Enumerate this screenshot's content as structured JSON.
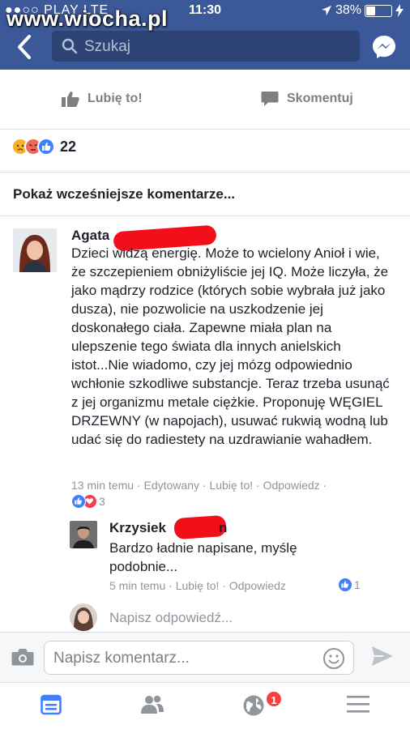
{
  "status_bar": {
    "carrier": "●●○○ PLAY  LTE",
    "time": "11:30",
    "battery": "38%",
    "battery_level": 0.38
  },
  "watermark": "www.wiocha.pl",
  "search": {
    "placeholder": "Szukaj"
  },
  "actions": {
    "like": "Lubię to!",
    "comment": "Skomentuj"
  },
  "reactions": {
    "count": "22"
  },
  "show_earlier": "Pokaż wcześniejsze komentarze...",
  "comments": [
    {
      "author": "Agata",
      "text": "Dzieci widzą energię. Może to wcielony Anioł i wie, że szczepieniem obniżyliście jej IQ. Może liczyła, że jako mądrzy rodzice (których sobie wybrała już jako dusza), nie pozwolicie na uszkodzenie jej doskonałego ciała. Zapewne miała plan na ulepszenie tego świata dla innych anielskich istot...Nie wiadomo, czy jej mózg odpowiednio wchłonie szkodliwe substancje. Teraz trzeba usunąć z jej organizmu metale ciężkie. Proponuję WĘGIEL DRZEWNY (w napojach), usuwać rukwią wodną lub udać się do radiestety na uzdrawianie wahadłem.",
      "time": "13 min temu",
      "edited": "Edytowany",
      "like": "Lubię to!",
      "reply": "Odpowiedz",
      "reaction_count": "3",
      "replies": [
        {
          "author": "Krzysiek",
          "author_suffix": "n",
          "text": "Bardzo ładnie napisane, myślę podobnie...",
          "time": "5 min temu",
          "like": "Lubię to!",
          "reply": "Odpowiedz",
          "reaction_count": "1"
        }
      ]
    }
  ],
  "reply_placeholder": "Napisz odpowiedź...",
  "composer": {
    "placeholder": "Napisz komentarz..."
  },
  "tabbar": {
    "notifications_badge": "1"
  },
  "colors": {
    "brand": "#3b5998",
    "like_blue": "#4080ff",
    "redaction": "#f20f1a",
    "badge": "#fa3e3e"
  }
}
